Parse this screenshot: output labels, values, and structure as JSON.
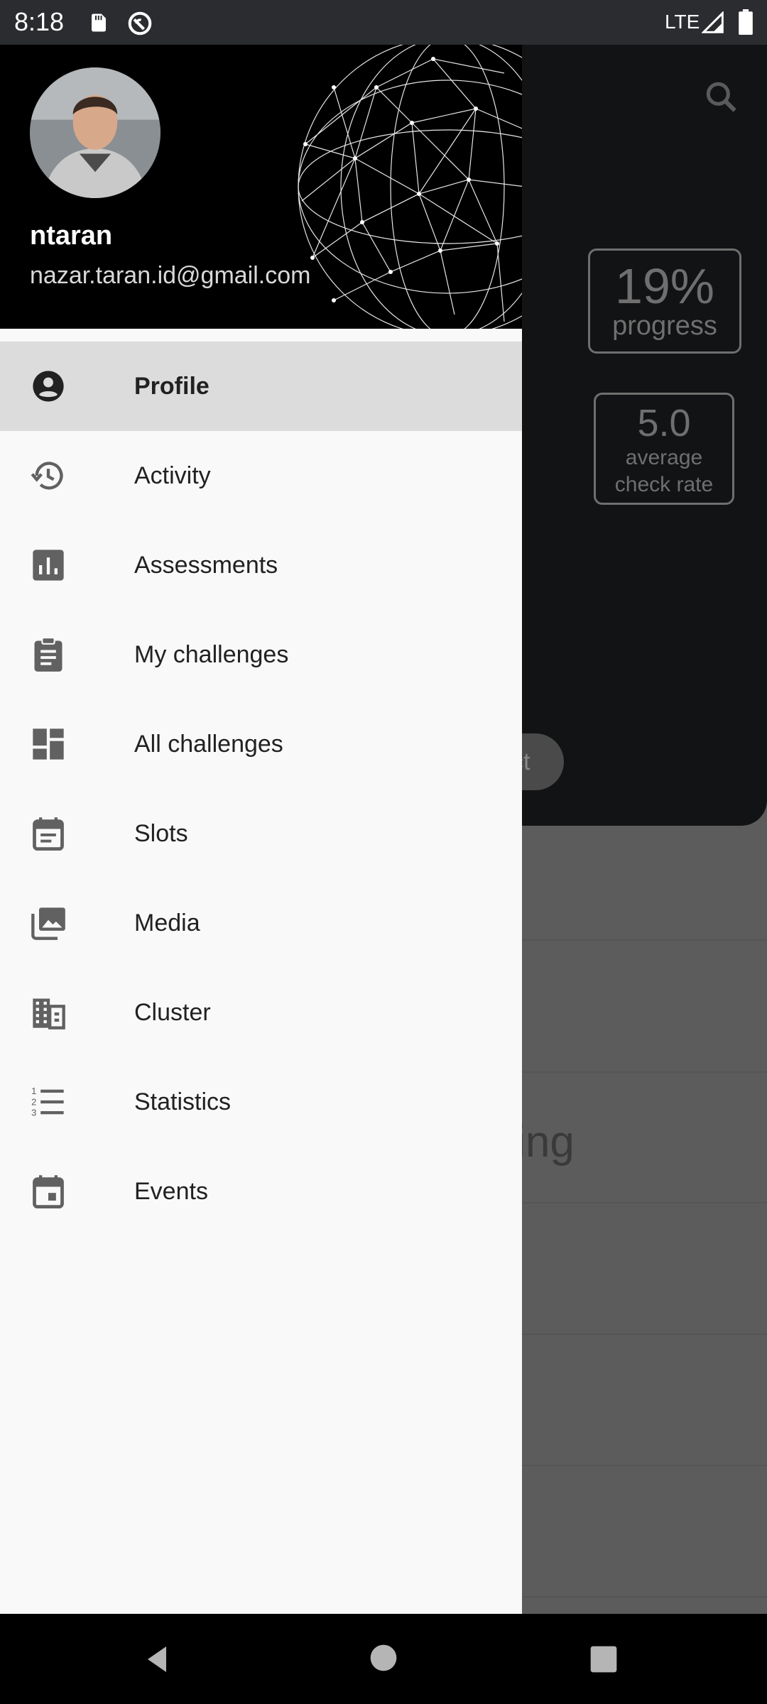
{
  "status_bar": {
    "time": "8:18",
    "network": "LTE",
    "icons": [
      "sd-card-icon",
      "do-not-disturb-icon",
      "signal-icon",
      "battery-icon"
    ]
  },
  "drawer": {
    "user": {
      "name": "ntaran",
      "email": "nazar.taran.id@gmail.com"
    },
    "items": [
      {
        "label": "Profile",
        "icon": "account-circle-icon",
        "active": true
      },
      {
        "label": "Activity",
        "icon": "history-icon",
        "active": false
      },
      {
        "label": "Assessments",
        "icon": "bar-chart-icon",
        "active": false
      },
      {
        "label": "My challenges",
        "icon": "clipboard-icon",
        "active": false
      },
      {
        "label": "All challenges",
        "icon": "dashboard-icon",
        "active": false
      },
      {
        "label": "Slots",
        "icon": "calendar-note-icon",
        "active": false
      },
      {
        "label": "Media",
        "icon": "photo-library-icon",
        "active": false
      },
      {
        "label": "Cluster",
        "icon": "building-icon",
        "active": false
      },
      {
        "label": "Statistics",
        "icon": "numbered-list-icon",
        "active": false
      },
      {
        "label": "Events",
        "icon": "event-icon",
        "active": false
      }
    ]
  },
  "background": {
    "progress_value": "19%",
    "progress_label": "progress",
    "check_rate_value": "5.0",
    "check_rate_label_1": "average",
    "check_rate_label_2": "check rate",
    "pill_text": "ct",
    "row_text": "nming"
  },
  "colors": {
    "drawer_bg": "#f9f9f9",
    "active_item_bg": "#dcdcdc",
    "header_bg": "#000000",
    "icon_color": "#616161"
  }
}
